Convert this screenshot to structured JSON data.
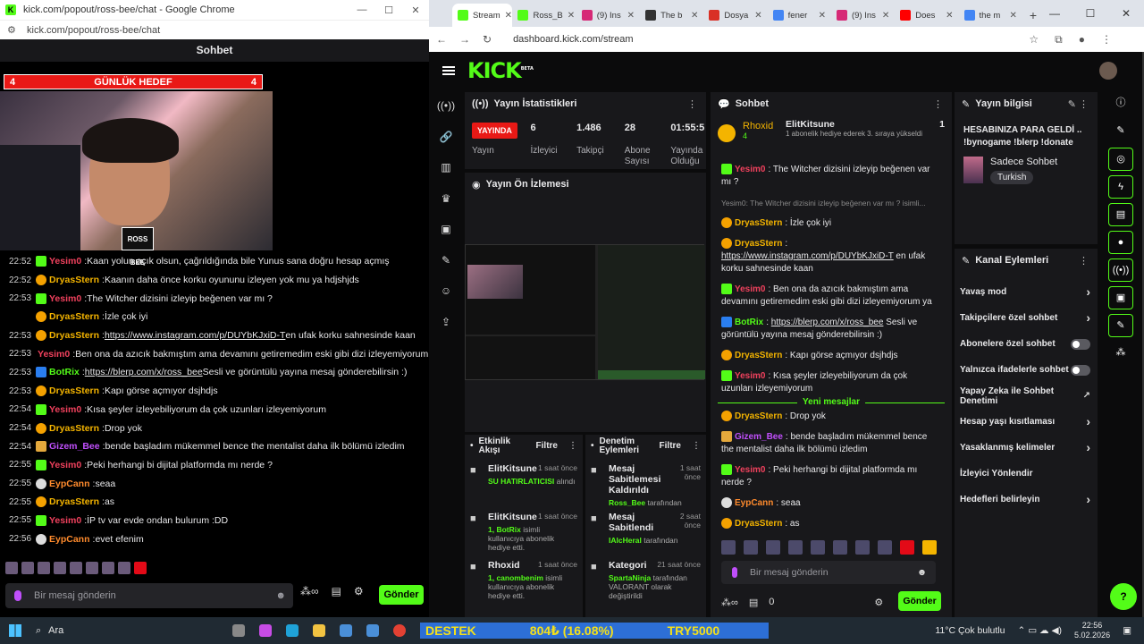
{
  "left_window": {
    "title": "kick.com/popout/ross-bee/chat - Google Chrome",
    "url": "kick.com/popout/ross-bee/chat",
    "chat_header": "Sohbet",
    "goal": {
      "left": "4",
      "label": "GÜNLÜK HEDEF",
      "right": "4"
    },
    "webcam_label": "ROSS BEE",
    "messages": [
      {
        "time": "22:52",
        "user": "Yesim0",
        "color": "red",
        "badge": "g",
        "text": "Kaan yolun açık olsun, çağrıldığında bile Yunus sana doğru hesap açmış"
      },
      {
        "time": "22:52",
        "user": "DryasStern",
        "color": "gold",
        "badge": "o",
        "text": "Kaanın daha önce korku oyununu izleyen yok mu ya hdjshjds"
      },
      {
        "time": "22:53",
        "user": "Yesim0",
        "color": "red",
        "badge": "g",
        "text": "The Witcher dizisini izleyip beğenen var mı ?"
      },
      {
        "time": "",
        "user": "DryasStern",
        "color": "gold",
        "badge": "o",
        "text": "İzle çok iyi"
      },
      {
        "time": "22:53",
        "user": "DryasStern",
        "color": "gold",
        "badge": "o",
        "link": "https://www.instagram.com/p/DUYbKJxiD-T",
        "text": " en ufak korku sahnesinde kaan"
      },
      {
        "time": "22:53",
        "user": "Yesim0",
        "color": "red",
        "badge": "g",
        "text": "Ben ona da azıcık bakmıştım ama devamını getiremedim eski gibi dizi izleyemiyorum ya"
      },
      {
        "time": "22:53",
        "user": "BotRix",
        "color": "green",
        "badge": "b",
        "link": "https://blerp.com/x/ross_bee",
        "text": " Sesli ve görüntülü yayına mesaj gönderebilirsin :)"
      },
      {
        "time": "22:53",
        "user": "DryasStern",
        "color": "gold",
        "badge": "o",
        "text": "Kapı görse açmıyor dsjhdjs"
      },
      {
        "time": "22:54",
        "user": "Yesim0",
        "color": "red",
        "badge": "g",
        "text": "Kısa şeyler izleyebiliyorum da çok uzunları izleyemiyorum"
      },
      {
        "time": "22:54",
        "user": "DryasStern",
        "color": "gold",
        "badge": "o",
        "text": "Drop yok"
      },
      {
        "time": "22:54",
        "user": "Gizem_Bee",
        "color": "purple",
        "badge": "y",
        "text": "bende başladım mükemmel bence the mentalist daha ilk bölümü izledim"
      },
      {
        "time": "22:55",
        "user": "Yesim0",
        "color": "red",
        "badge": "g",
        "text": "Peki herhangi bi dijital platformda mı nerde ?"
      },
      {
        "time": "22:55",
        "user": "EypCann",
        "color": "orange",
        "badge": "w",
        "text": "seaa"
      },
      {
        "time": "22:55",
        "user": "DryasStern",
        "color": "gold",
        "badge": "o",
        "text": "as"
      },
      {
        "time": "22:55",
        "user": "Yesim0",
        "color": "red",
        "badge": "g",
        "text": "İP tv var evde ondan bulurum :DD"
      },
      {
        "time": "22:56",
        "user": "EypCann",
        "color": "orange",
        "badge": "w",
        "text": "evet efenim"
      }
    ],
    "input_placeholder": "Bir mesaj gönderin",
    "send_label": "Gönder"
  },
  "browser": {
    "tabs": [
      {
        "label": "Stream",
        "color": "#53fc18",
        "active": true
      },
      {
        "label": "Ross_B",
        "color": "#53fc18"
      },
      {
        "label": "(9) Ins",
        "color": "#d62976"
      },
      {
        "label": "The b",
        "color": "#333"
      },
      {
        "label": "Dosya",
        "color": "#d93025"
      },
      {
        "label": "fener",
        "color": "#4285f4"
      },
      {
        "label": "(9) Ins",
        "color": "#d62976"
      },
      {
        "label": "Does",
        "color": "#ff0000"
      },
      {
        "label": "the m",
        "color": "#4285f4"
      }
    ],
    "url": "dashboard.kick.com/stream"
  },
  "dashboard": {
    "logo": "KICK",
    "logo_badge": "BETA",
    "stats": {
      "title": "Yayın İstatistikleri",
      "live": "YAYINDA",
      "live_label": "Yayın",
      "viewers": "6",
      "viewers_label": "İzleyici",
      "followers": "1.486",
      "followers_label": "Takipçi",
      "subs": "28",
      "subs_label": "Abone Sayısı",
      "uptime": "01:55:5",
      "uptime_label": "Yayında Olduğu"
    },
    "preview_title": "Yayın Ön İzlemesi",
    "activity": {
      "title": "Etkinlik Akışı",
      "filter": "Filtre",
      "items": [
        {
          "name": "ElitKitsune",
          "time": "1 saat önce",
          "action": "SU HATIRLATICISI",
          "rest": "alındı"
        },
        {
          "name": "ElitKitsune",
          "time": "1 saat önce",
          "action": "1, BotRix",
          "rest": "isimli kullanıcıya abonelik hediye etti."
        },
        {
          "name": "Rhoxid",
          "time": "1 saat önce",
          "action": "1, canombenim",
          "rest": "isimli kullanıcıya abonelik hediye etti."
        }
      ]
    },
    "moderation": {
      "title": "Denetim Eylemleri",
      "filter": "Filtre",
      "items": [
        {
          "name": "Mesaj Sabitlemesi Kaldırıldı",
          "time": "1 saat önce",
          "action": "Ross_Bee",
          "rest": "tarafından"
        },
        {
          "name": "Mesaj Sabitlendi",
          "time": "2 saat önce",
          "action": "IAlcHeral",
          "rest": "tarafından"
        },
        {
          "name": "Kategori",
          "time": "21 saat önce",
          "action": "SpartaNinja",
          "rest": "tarafından VALORANT olarak değiştirildi"
        }
      ]
    },
    "chat": {
      "title": "Sohbet",
      "pinned_user": "Rhoxid",
      "pinned_count": "4",
      "pinned_gifter": "ElitKitsune",
      "pinned_num": "1",
      "pinned_text": "1 abonelik hediye ederek 3. sıraya yükseldi",
      "reply_hint": "Yesim0: The Witcher dizisini izleyip beğenen var mı ? isimli...",
      "new_messages": "Yeni mesajlar",
      "input_placeholder": "Bir mesaj gönderin",
      "points": "0",
      "send_label": "Gönder"
    },
    "info": {
      "title": "Yayın bilgisi",
      "stream_title": "HESABINIZA PARA GELDİ .. !bynogame !blerp !donate",
      "category": "Sadece Sohbet",
      "language": "Turkish"
    },
    "actions": {
      "title": "Kanal Eylemleri",
      "items": [
        {
          "label": "Yavaş mod",
          "kind": "arrow"
        },
        {
          "label": "Takipçilere özel sohbet",
          "kind": "arrow"
        },
        {
          "label": "Abonelere özel sohbet",
          "kind": "toggle"
        },
        {
          "label": "Yalnızca ifadelerle sohbet",
          "kind": "toggle"
        },
        {
          "label": "Yapay Zeka ile Sohbet Denetimi",
          "kind": "ext"
        },
        {
          "label": "Hesap yaşı kısıtlaması",
          "kind": "arrow"
        },
        {
          "label": "Yasaklanmış kelimeler",
          "kind": "arrow"
        },
        {
          "label": "İzleyici Yönlendir",
          "kind": "none"
        },
        {
          "label": "Hedefleri belirleyin",
          "kind": "arrow"
        }
      ]
    }
  },
  "taskbar": {
    "search": "Ara",
    "ticker_1": "DESTEK",
    "ticker_2": "804₺ (16.08%)",
    "ticker_3": "TRY5000",
    "weather": "11°C  Çok bulutlu",
    "time": "22:56",
    "date": "5.02.2026"
  },
  "colors": {
    "kick_green": "#53fc18",
    "live_red": "#e91916",
    "panel_bg": "#18181b"
  }
}
